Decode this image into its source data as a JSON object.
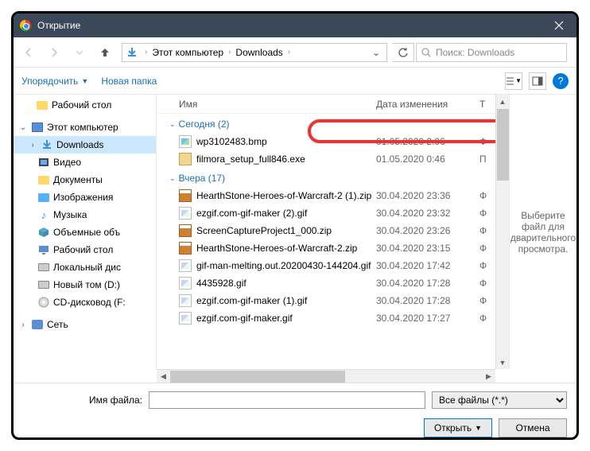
{
  "title": "Открытие",
  "breadcrumb": {
    "root": "Этот компьютер",
    "folder": "Downloads"
  },
  "search": {
    "placeholder": "Поиск: Downloads"
  },
  "toolbar": {
    "organize": "Упорядочить",
    "newfolder": "Новая папка"
  },
  "columns": {
    "name": "Имя",
    "date": "Дата изменения",
    "type": "Т"
  },
  "tree": {
    "desktop": "Рабочий стол",
    "thispc": "Этот компьютер",
    "downloads": "Downloads",
    "videos": "Видео",
    "documents": "Документы",
    "pictures": "Изображения",
    "music": "Музыка",
    "objects3d": "Объемные объ",
    "desktop2": "Рабочий стол",
    "localdisk": "Локальный дис",
    "newvol": "Новый том (D:)",
    "cddrive": "CD-дисковод (F:",
    "network": "Сеть"
  },
  "groups": {
    "today": {
      "label": "Сегодня",
      "count": "(2)"
    },
    "yesterday": {
      "label": "Вчера",
      "count": "(17)"
    }
  },
  "files": {
    "today": [
      {
        "name": "wp3102483.bmp",
        "date": "01.05.2020 2:06",
        "type": "Ф",
        "icon": "img"
      },
      {
        "name": "filmora_setup_full846.exe",
        "date": "01.05.2020 0:46",
        "type": "П",
        "icon": "exe"
      }
    ],
    "yesterday": [
      {
        "name": "HearthStone-Heroes-of-Warcraft-2 (1).zip",
        "date": "30.04.2020 23:36",
        "type": "Ф",
        "icon": "zip"
      },
      {
        "name": "ezgif.com-gif-maker (2).gif",
        "date": "30.04.2020 23:32",
        "type": "Ф",
        "icon": "gif"
      },
      {
        "name": "ScreenCaptureProject1_000.zip",
        "date": "30.04.2020 23:26",
        "type": "Ф",
        "icon": "zip"
      },
      {
        "name": "HearthStone-Heroes-of-Warcraft-2.zip",
        "date": "30.04.2020 23:15",
        "type": "Ф",
        "icon": "zip"
      },
      {
        "name": "gif-man-melting.out.20200430-144204.gif",
        "date": "30.04.2020 17:42",
        "type": "Ф",
        "icon": "gif"
      },
      {
        "name": "4435928.gif",
        "date": "30.04.2020 17:28",
        "type": "Ф",
        "icon": "gif"
      },
      {
        "name": "ezgif.com-gif-maker (1).gif",
        "date": "30.04.2020 17:28",
        "type": "Ф",
        "icon": "gif"
      },
      {
        "name": "ezgif.com-gif-maker.gif",
        "date": "30.04.2020 17:27",
        "type": "Ф",
        "icon": "gif"
      }
    ]
  },
  "preview": "Выберите файл для дварительного просмотра.",
  "bottom": {
    "filename_label": "Имя файла:",
    "filter": "Все файлы (*.*)",
    "open": "Открыть",
    "cancel": "Отмена"
  }
}
